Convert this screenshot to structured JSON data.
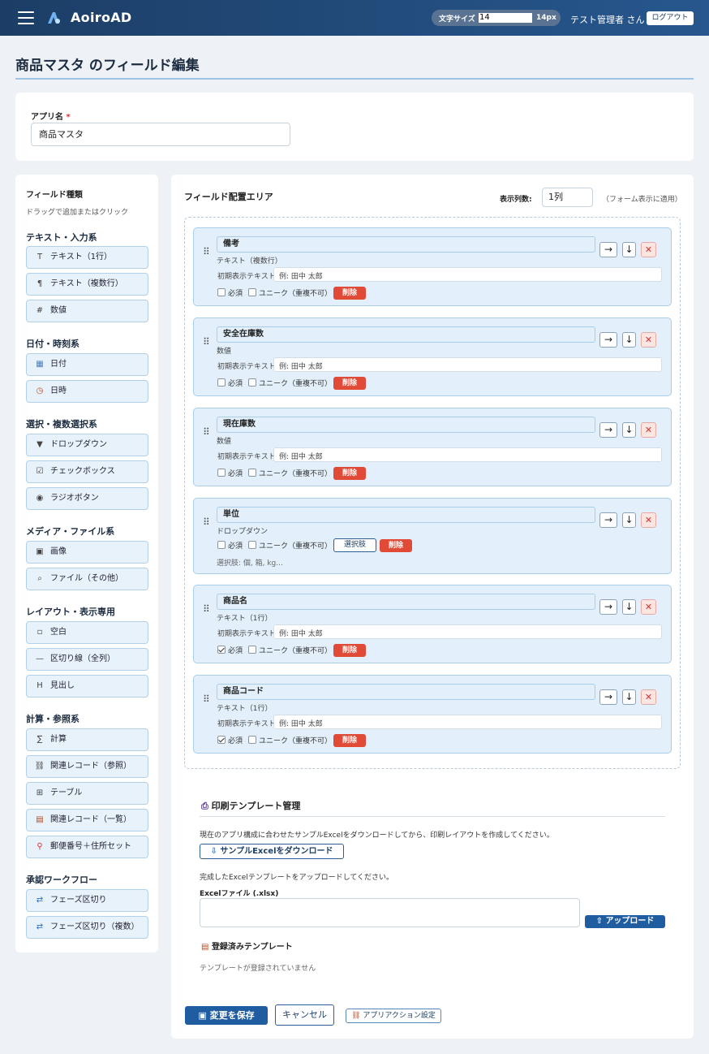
{
  "header": {
    "brand": "AoiroAD",
    "font_size_label": "文字サイズ",
    "font_size_value": "14",
    "font_size_display": "14px",
    "user": "テスト管理者 さん",
    "logout": "ログアウト"
  },
  "page": {
    "title": "商品マスタ のフィールド編集"
  },
  "app_name": {
    "label": "アプリ名",
    "required_mark": "*",
    "value": "商品マスタ"
  },
  "palette": {
    "title": "フィールド種類",
    "hint": "ドラッグで追加またはクリック",
    "groups": [
      {
        "title": "テキスト・入力系",
        "items": [
          {
            "icon": "T",
            "label": "テキスト（1行）"
          },
          {
            "icon": "¶",
            "label": "テキスト（複数行）"
          },
          {
            "icon": "#",
            "label": "数値"
          }
        ]
      },
      {
        "title": "日付・時刻系",
        "items": [
          {
            "icon": "▦",
            "label": "日付"
          },
          {
            "icon": "◷",
            "label": "日時"
          }
        ]
      },
      {
        "title": "選択・複数選択系",
        "items": [
          {
            "icon": "▼",
            "label": "ドロップダウン"
          },
          {
            "icon": "☑",
            "label": "チェックボックス"
          },
          {
            "icon": "◉",
            "label": "ラジオボタン"
          }
        ]
      },
      {
        "title": "メディア・ファイル系",
        "items": [
          {
            "icon": "▣",
            "label": "画像"
          },
          {
            "icon": "⌕",
            "label": "ファイル（その他）"
          }
        ]
      },
      {
        "title": "レイアウト・表示専用",
        "items": [
          {
            "icon": "▫",
            "label": "空白"
          },
          {
            "icon": "—",
            "label": "区切り線（全列）"
          },
          {
            "icon": "H",
            "label": "見出し"
          }
        ]
      },
      {
        "title": "計算・参照系",
        "items": [
          {
            "icon": "∑",
            "label": "計算"
          },
          {
            "icon": "⛓",
            "label": "関連レコード（参照）"
          },
          {
            "icon": "⊞",
            "label": "テーブル"
          },
          {
            "icon": "▤",
            "label": "関連レコード（一覧）"
          },
          {
            "icon": "⚲",
            "label": "郵便番号＋住所セット"
          }
        ]
      },
      {
        "title": "承認ワークフロー",
        "items": [
          {
            "icon": "⇄",
            "label": "フェーズ区切り"
          },
          {
            "icon": "⇄",
            "label": "フェーズ区切り（複数）"
          }
        ]
      }
    ]
  },
  "layout": {
    "title": "フィールド配置エリア",
    "columns_label": "表示列数:",
    "columns_value": "1列",
    "columns_note": "（フォーム表示に適用）",
    "default_label": "初期表示テキスト:",
    "default_placeholder": "例: 田中 太郎",
    "required_label": "必須",
    "unique_label": "ユニーク（重複不可）",
    "delete_label": "削除",
    "options_label": "選択肢",
    "fields": [
      {
        "name": "備考",
        "type": "テキスト（複数行）",
        "required": false
      },
      {
        "name": "安全在庫数",
        "type": "数値",
        "required": false
      },
      {
        "name": "現在庫数",
        "type": "数値",
        "required": false
      },
      {
        "name": "単位",
        "type": "ドロップダウン",
        "required": false,
        "options_note": "選択肢: 個, 箱, kg..."
      },
      {
        "name": "商品名",
        "type": "テキスト（1行）",
        "required": true
      },
      {
        "name": "商品コード",
        "type": "テキスト（1行）",
        "required": true
      }
    ]
  },
  "print": {
    "title": "印刷テンプレート管理",
    "desc": "現在のアプリ構成に合わせたサンプルExcelをダウンロードしてから、印刷レイアウトを作成してください。",
    "download": "サンプルExcelをダウンロード",
    "upload_hint": "完成したExcelテンプレートをアップロードしてください。",
    "file_label": "Excelファイル (.xlsx)",
    "upload": "アップロード",
    "registered_title": "登録済みテンプレート",
    "registered_empty": "テンプレートが登録されていません"
  },
  "actions": {
    "save": "変更を保存",
    "cancel": "キャンセル",
    "app_action": "アプリアクション設定"
  }
}
